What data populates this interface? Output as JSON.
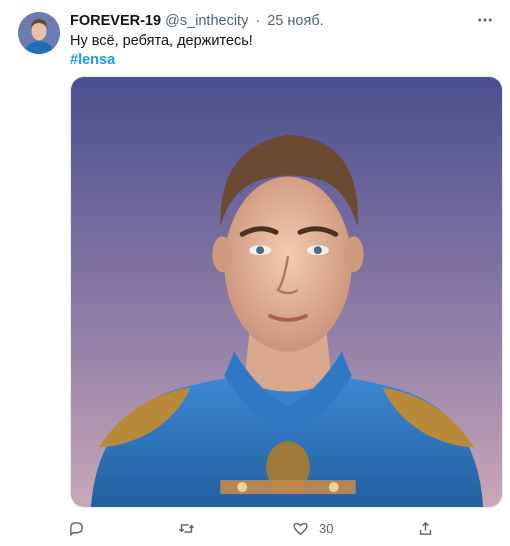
{
  "author": {
    "display_name": "FOREVER-19",
    "handle": "@s_inthecity",
    "separator": "·",
    "date": "25 нояб."
  },
  "tweet": {
    "text": "Ну всё, ребята, держитесь!",
    "hashtag": "#lensa"
  },
  "media": {
    "description_icon": "portrait-image"
  },
  "actions": {
    "like_count": "30"
  },
  "colors": {
    "link": "#1d9bf0",
    "secondary_text": "#536471",
    "primary_text": "#0f1419"
  }
}
